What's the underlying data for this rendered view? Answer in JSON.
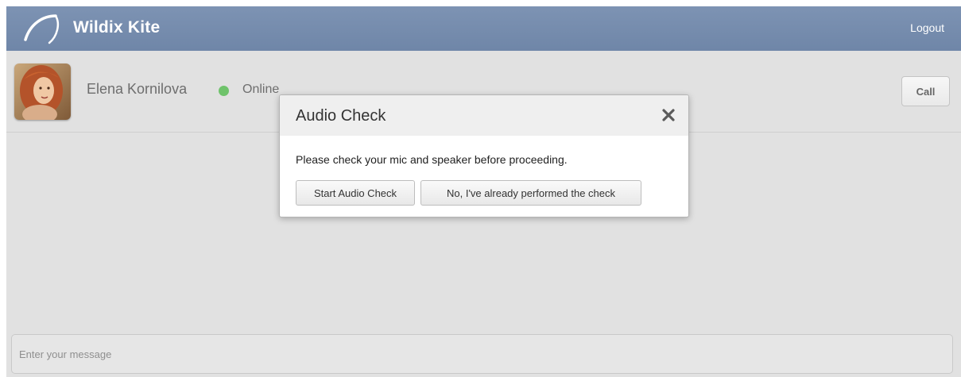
{
  "header": {
    "brand": "Wildix Kite",
    "logout_label": "Logout"
  },
  "contact": {
    "name": "Elena Kornilova",
    "status": "Online",
    "status_color": "#6fc36b",
    "call_label": "Call"
  },
  "composer": {
    "placeholder": "Enter your message"
  },
  "modal": {
    "title": "Audio Check",
    "close_icon": "close-icon",
    "message": "Please check your mic and speaker before proceeding.",
    "start_label": "Start Audio Check",
    "skip_label": "No, I've already performed the check"
  },
  "colors": {
    "header_bg": "#7589ab",
    "page_bg": "#e1e1e1"
  }
}
